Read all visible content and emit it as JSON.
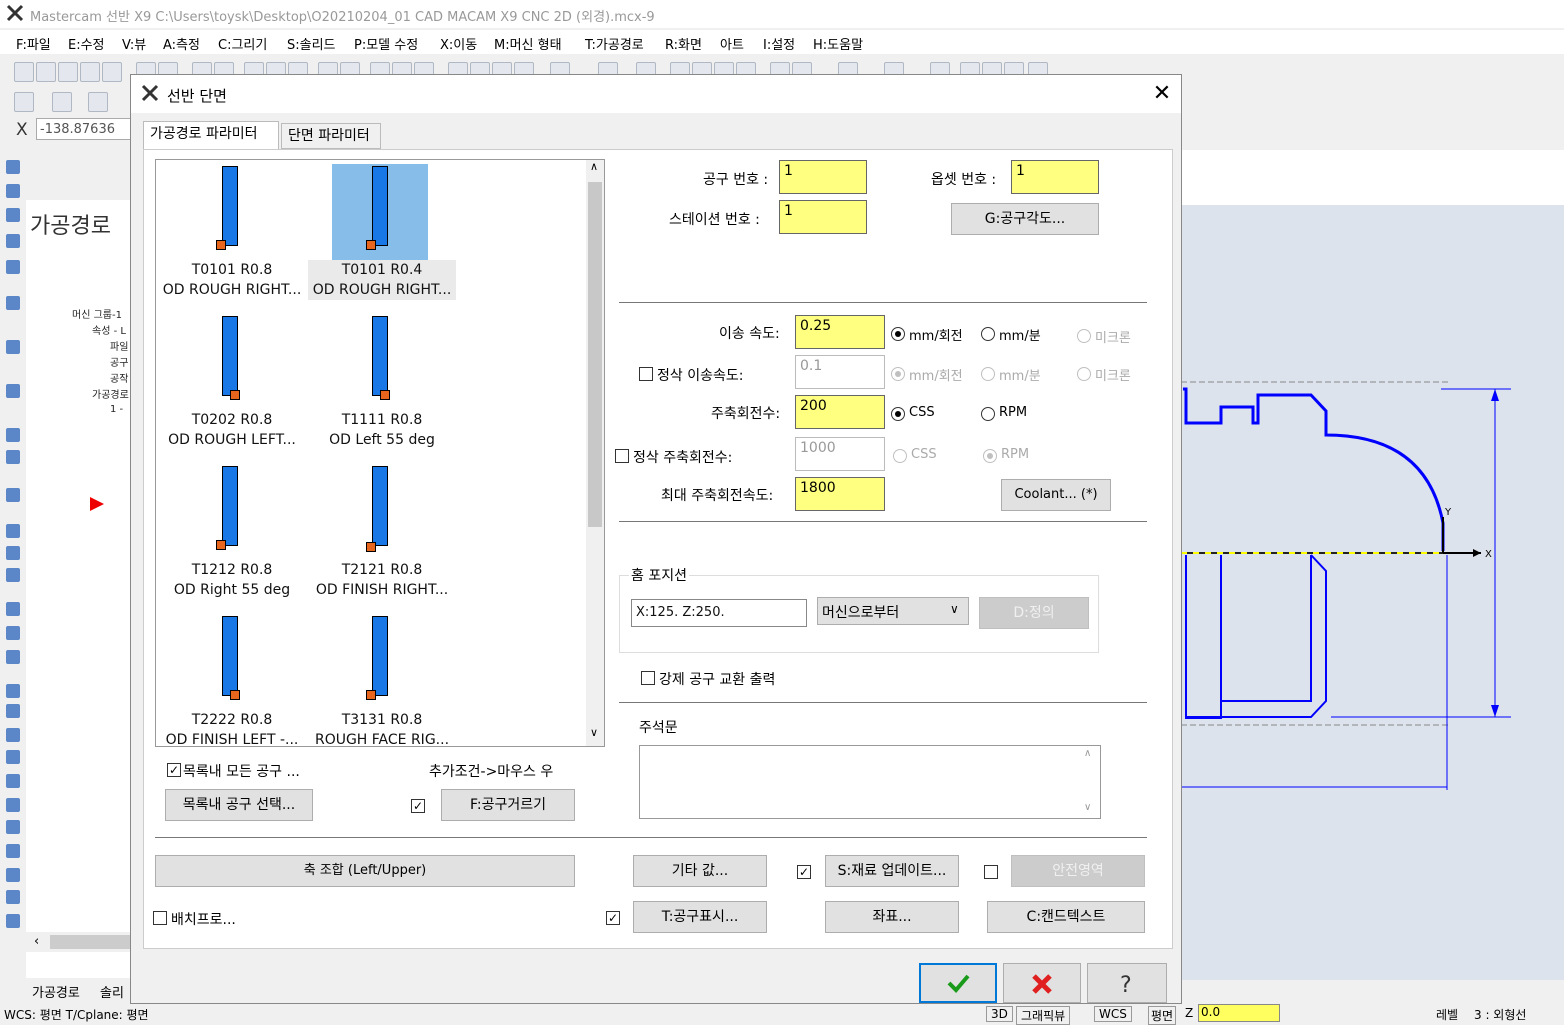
{
  "app": {
    "title": "Mastercam 선반 X9  C:\\Users\\toysk\\Desktop\\O20210204_01 CAD MACAM X9 CNC 2D (외경).mcx-9",
    "menu": [
      "F:파일",
      "E:수정",
      "V:뷰",
      "A:측정",
      "C:그리기",
      "S:솔리드",
      "P:모델 수정",
      "X:이동",
      "M:머신 형태",
      "T:가공경로",
      "R:화면",
      "아트",
      "I:설정",
      "H:도움말"
    ],
    "x_label": "X",
    "x_value": "-138.87636",
    "panel_title": "가공경로",
    "tree": [
      "머신 그룹-1",
      "속성 - L",
      "파일",
      "공구",
      "공작",
      "가공경로",
      "1 -"
    ],
    "bottom_tabs": [
      "가공경로",
      "솔리"
    ],
    "status": {
      "wcs": "WCS: 평면  T/Cplane: 평면",
      "btn_3d": "3D",
      "btn_graphics": "그래픽뷰",
      "btn_wcs": "WCS",
      "btn_plane": "평면",
      "z_label": "Z",
      "z_value": "0.0",
      "level_label": "레벨",
      "level_value": "3 : 외형선"
    }
  },
  "dialog": {
    "title": "선반 단면",
    "tabs": [
      "가공경로 파라미터",
      "단면 파라미터"
    ],
    "tools": [
      {
        "line1": "T0101 R0.8",
        "line2": "OD ROUGH RIGHT..."
      },
      {
        "line1": "T0101 R0.4",
        "line2": "OD ROUGH RIGHT..."
      },
      {
        "line1": "T0202 R0.8",
        "line2": "OD ROUGH LEFT..."
      },
      {
        "line1": "T1111 R0.8",
        "line2": "OD Left 55 deg"
      },
      {
        "line1": "T1212 R0.8",
        "line2": "OD Right 55 deg"
      },
      {
        "line1": "T2121 R0.8",
        "line2": "OD FINISH RIGHT..."
      },
      {
        "line1": "T2222 R0.8",
        "line2": "OD FINISH LEFT -..."
      },
      {
        "line1": "T3131 R0.8",
        "line2": "ROUGH FACE RIG..."
      }
    ],
    "show_all_label": "목록내 모든 공구 ...",
    "extra_label": "추가조건->마우스 우",
    "select_tool_btn": "목록내 공구 선택...",
    "filter_btn": "F:공구거르기",
    "tool_no_label": "공구 번호 :",
    "tool_no": "1",
    "offset_no_label": "옵셋 번호 :",
    "offset_no": "1",
    "station_label": "스테이션 번호 :",
    "station_no": "1",
    "tool_angle_btn": "G:공구각도...",
    "feed_label": "이송 속도:",
    "feed": "0.25",
    "unit_mm_rev": "mm/회전",
    "unit_mm_min": "mm/분",
    "unit_micron": "미크론",
    "finish_feed_label": "정삭 이송속도:",
    "finish_feed": "0.1",
    "spindle_label": "주축회전수:",
    "spindle": "200",
    "css": "CSS",
    "rpm": "RPM",
    "finish_spindle_label": "정삭 주축회전수:",
    "finish_spindle": "1000",
    "max_spindle_label": "최대 주축회전속도:",
    "max_spindle": "1800",
    "coolant_btn": "Coolant... (*)",
    "home_label": "홈 포지션",
    "home_value": "X:125.  Z:250.",
    "home_select": "머신으로부터",
    "define_btn": "D:정의",
    "force_toolchange": "강제 공구 교환 출력",
    "comment_label": "주석문",
    "axis_combo_btn": "축 조합 (Left/Upper)",
    "misc_btn": "기타 값...",
    "stock_update_btn": "S:재료 업데이트...",
    "safety_btn": "안전영역",
    "batch_label": "배치프로...",
    "tool_display_btn": "T:공구표시...",
    "coords_btn": "좌표...",
    "canned_btn": "C:캔드텍스트"
  },
  "colors": {
    "yellow_field": "#ffff80",
    "tool_blue": "#1a78e6",
    "insert_orange": "#e8651d",
    "selection": "#87bde9",
    "drawing": "#0000ff"
  }
}
